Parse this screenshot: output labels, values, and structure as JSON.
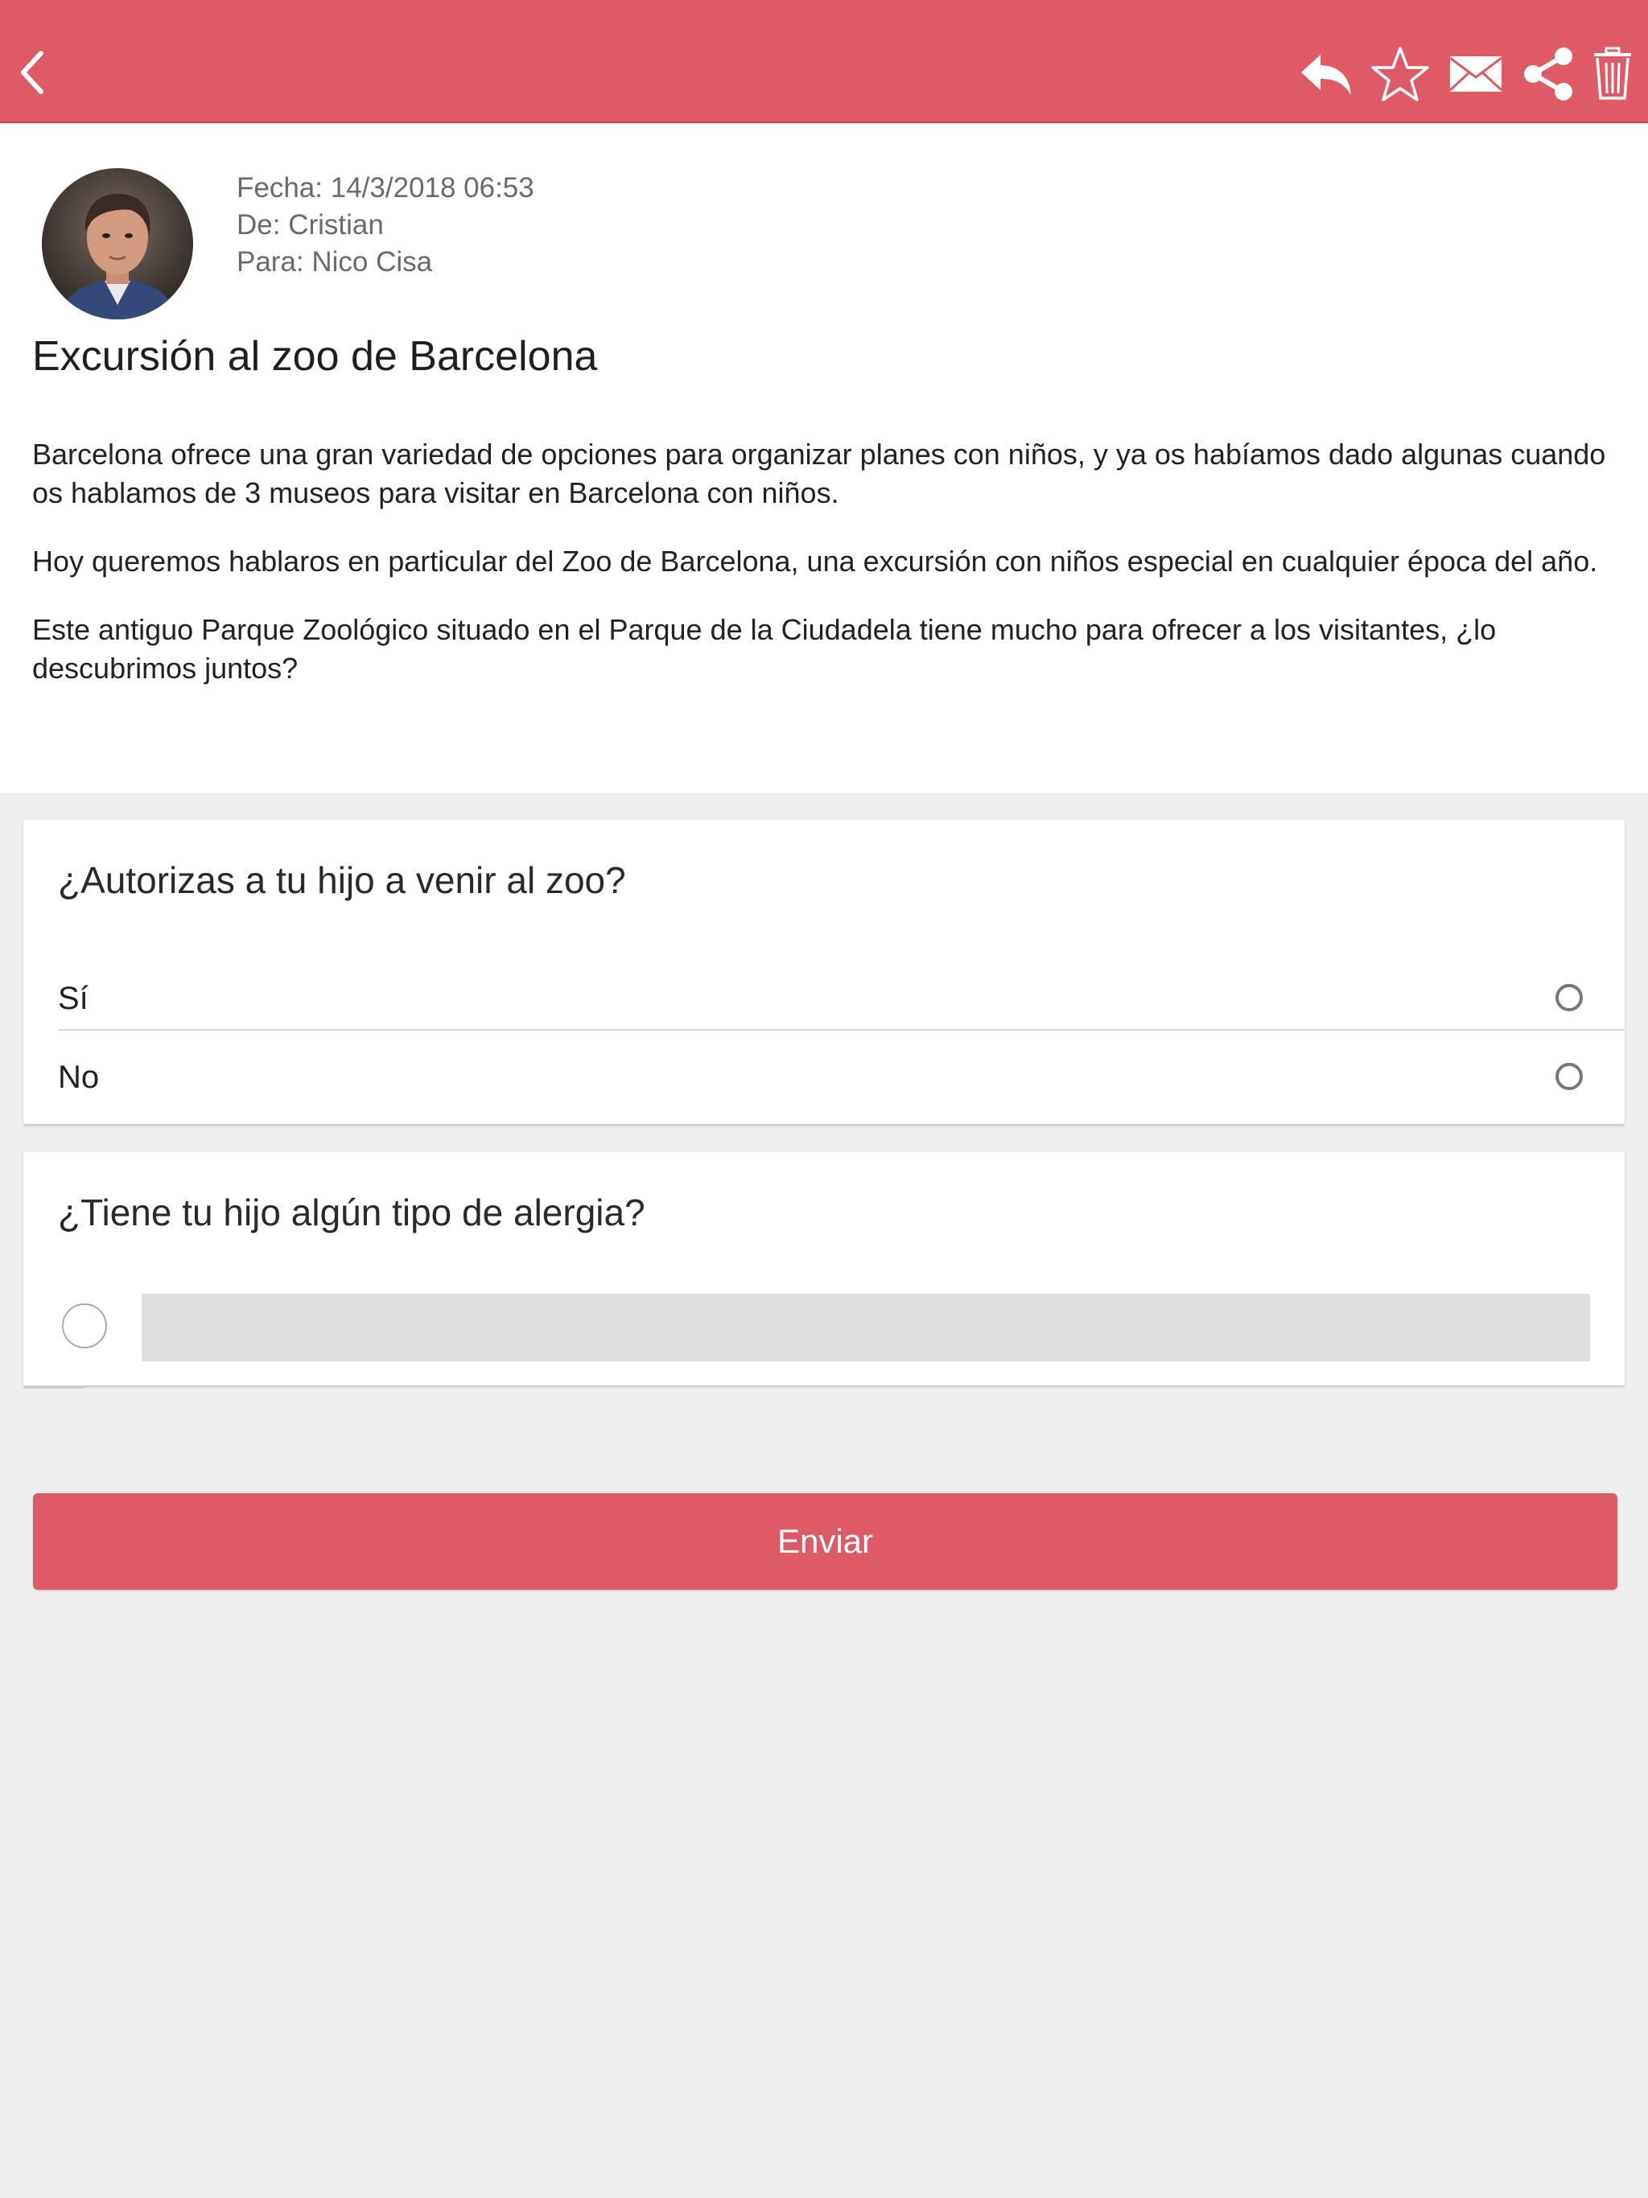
{
  "toolbar": {
    "back_icon": "chevron-left-icon",
    "actions": [
      "reply-icon",
      "star-icon",
      "envelope-icon",
      "share-icon",
      "trash-icon"
    ],
    "color": "#dd5a66"
  },
  "message": {
    "date_line": "Fecha: 14/3/2018 06:53",
    "from_line": "De: Cristian",
    "to_line": "Para: Nico Cisa",
    "subject": "Excursión al zoo de Barcelona",
    "paragraphs": [
      "Barcelona ofrece una gran variedad de opciones para organizar planes con niños, y ya os habíamos dado algunas cuando os hablamos de 3 museos para visitar en Barcelona con niños.",
      "Hoy queremos hablaros en particular del Zoo de Barcelona, una excursión con niños especial en cualquier época del año.",
      "Este antiguo Parque Zoológico situado en el Parque de la Ciudadela tiene mucho para ofrecer a los visitantes, ¿lo descubrimos juntos?"
    ]
  },
  "survey": {
    "q1": {
      "title": "¿Autorizas a tu hijo a venir al zoo?",
      "options": [
        "Sí",
        "No"
      ]
    },
    "q2": {
      "title": "¿Tiene tu hijo algún tipo de alergia?",
      "input_value": ""
    }
  },
  "submit_label": "Enviar",
  "accent_color": "#dd5a66",
  "background_color": "#eeeeee"
}
